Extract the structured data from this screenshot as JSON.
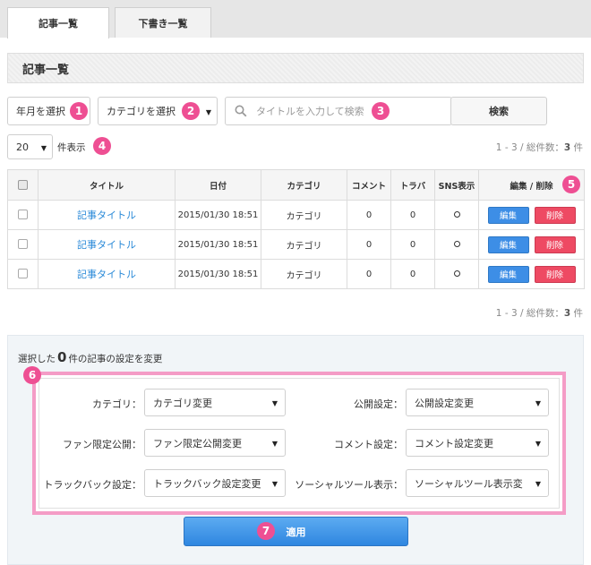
{
  "tabs": [
    {
      "label": "記事一覧",
      "active": true
    },
    {
      "label": "下書き一覧",
      "active": false
    }
  ],
  "section_title": "記事一覧",
  "filters": {
    "month_select": "年月を選択",
    "category_select": "カテゴリを選択",
    "search_placeholder": "タイトルを入力して検索",
    "search_button": "検索",
    "per_page_value": "20",
    "per_page_suffix": "件表示"
  },
  "pager": {
    "range": "1 - 3",
    "total_label": "総件数",
    "total": "3",
    "unit": "件"
  },
  "badges": [
    "1",
    "2",
    "3",
    "4",
    "5",
    "6",
    "7"
  ],
  "table": {
    "headers": [
      "タイトル",
      "日付",
      "カテゴリ",
      "コメント",
      "トラバ",
      "SNS表示",
      "編集 / 削除"
    ],
    "rows": [
      {
        "title": "記事タイトル",
        "date": "2015/01/30 18:51",
        "category": "カテゴリ",
        "comments": "0",
        "trackbacks": "0",
        "edit": "編集",
        "delete": "削除"
      },
      {
        "title": "記事タイトル",
        "date": "2015/01/30 18:51",
        "category": "カテゴリ",
        "comments": "0",
        "trackbacks": "0",
        "edit": "編集",
        "delete": "削除"
      },
      {
        "title": "記事タイトル",
        "date": "2015/01/30 18:51",
        "category": "カテゴリ",
        "comments": "0",
        "trackbacks": "0",
        "edit": "編集",
        "delete": "削除"
      }
    ]
  },
  "bulk": {
    "prefix": "選択した",
    "count": "0",
    "suffix": "件の記事の設定を変更",
    "fields": {
      "category": {
        "label": "カテゴリ：",
        "value": "カテゴリ変更"
      },
      "publish": {
        "label": "公開設定：",
        "value": "公開設定変更"
      },
      "fan_only": {
        "label": "ファン限定公開：",
        "value": "ファン限定公開変更"
      },
      "comment": {
        "label": "コメント設定：",
        "value": "コメント設定変更"
      },
      "trackback": {
        "label": "トラックバック設定：",
        "value": "トラックバック設定変更"
      },
      "social": {
        "label": "ソーシャルツール表示：",
        "value": "ソーシャルツール表示変"
      }
    },
    "apply_button": "適用"
  },
  "colors": {
    "accent_pink": "#ee4f93",
    "primary_blue": "#3d8ee6",
    "danger_red": "#ee4a63",
    "link_blue": "#2a8ad8"
  }
}
